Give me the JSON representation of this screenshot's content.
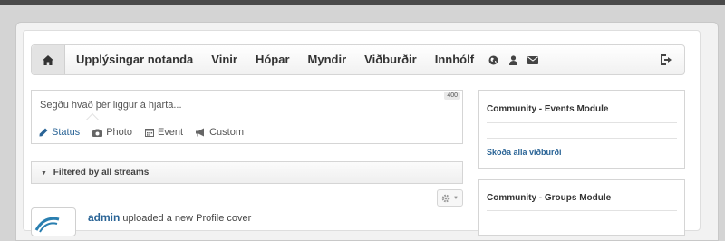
{
  "navbar": {
    "items": [
      {
        "label": "Upplýsingar notanda"
      },
      {
        "label": "Vinir"
      },
      {
        "label": "Hópar"
      },
      {
        "label": "Myndir"
      },
      {
        "label": "Viðburðir"
      },
      {
        "label": "Innhólf"
      }
    ],
    "icons": [
      "home-icon",
      "globe-icon",
      "user-icon",
      "envelope-icon",
      "logout-icon"
    ]
  },
  "status_box": {
    "placeholder": "Segðu hvað þér liggur á hjarta...",
    "char_count": "400",
    "tabs": [
      {
        "label": "Status",
        "icon": "pencil-icon",
        "active": true
      },
      {
        "label": "Photo",
        "icon": "camera-icon"
      },
      {
        "label": "Event",
        "icon": "calendar-icon"
      },
      {
        "label": "Custom",
        "icon": "bullhorn-icon"
      }
    ]
  },
  "filter": {
    "label": "Filtered by all streams"
  },
  "activity": {
    "user": "admin",
    "text": "uploaded a new Profile cover"
  },
  "modules": [
    {
      "title": "Community - Events Module",
      "link": "Skoða alla viðburði"
    },
    {
      "title": "Community - Groups Module"
    }
  ],
  "colors": {
    "link": "#2a6496",
    "text": "#333333",
    "topbar": "#4a4a4a"
  }
}
